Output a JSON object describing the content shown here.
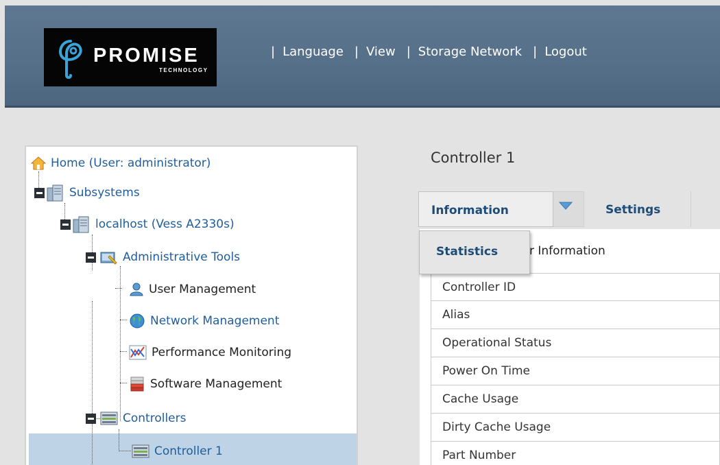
{
  "header": {
    "logo": {
      "brand": "PROMISE",
      "tagline": "TECHNOLOGY"
    },
    "nav": [
      {
        "label": "Language"
      },
      {
        "label": "View"
      },
      {
        "label": "Storage Network"
      },
      {
        "label": "Logout"
      }
    ],
    "separator": "|"
  },
  "tree": {
    "home": "Home (User: administrator)",
    "subsystems": "Subsystems",
    "localhost": "localhost (Vess A2330s)",
    "admin_tools": "Administrative Tools",
    "user_mgmt": "User Management",
    "network_mgmt": "Network Management",
    "perf_mon": "Performance Monitoring",
    "software_mgmt": "Software Management",
    "controllers": "Controllers",
    "controller1": "Controller 1"
  },
  "main": {
    "title": "Controller 1",
    "tabs": {
      "information": "Information",
      "settings": "Settings"
    },
    "dropdown": {
      "statistics": "Statistics"
    },
    "section_title_visible": "r Information",
    "properties": [
      "Controller ID",
      "Alias",
      "Operational Status",
      "Power On Time",
      "Cache Usage",
      "Dirty Cache Usage",
      "Part Number"
    ]
  },
  "colors": {
    "header_bg": "#56708a",
    "link_blue": "#1f5d9c",
    "tab_text": "#1d4c78",
    "selected_row": "#bed3e6"
  }
}
